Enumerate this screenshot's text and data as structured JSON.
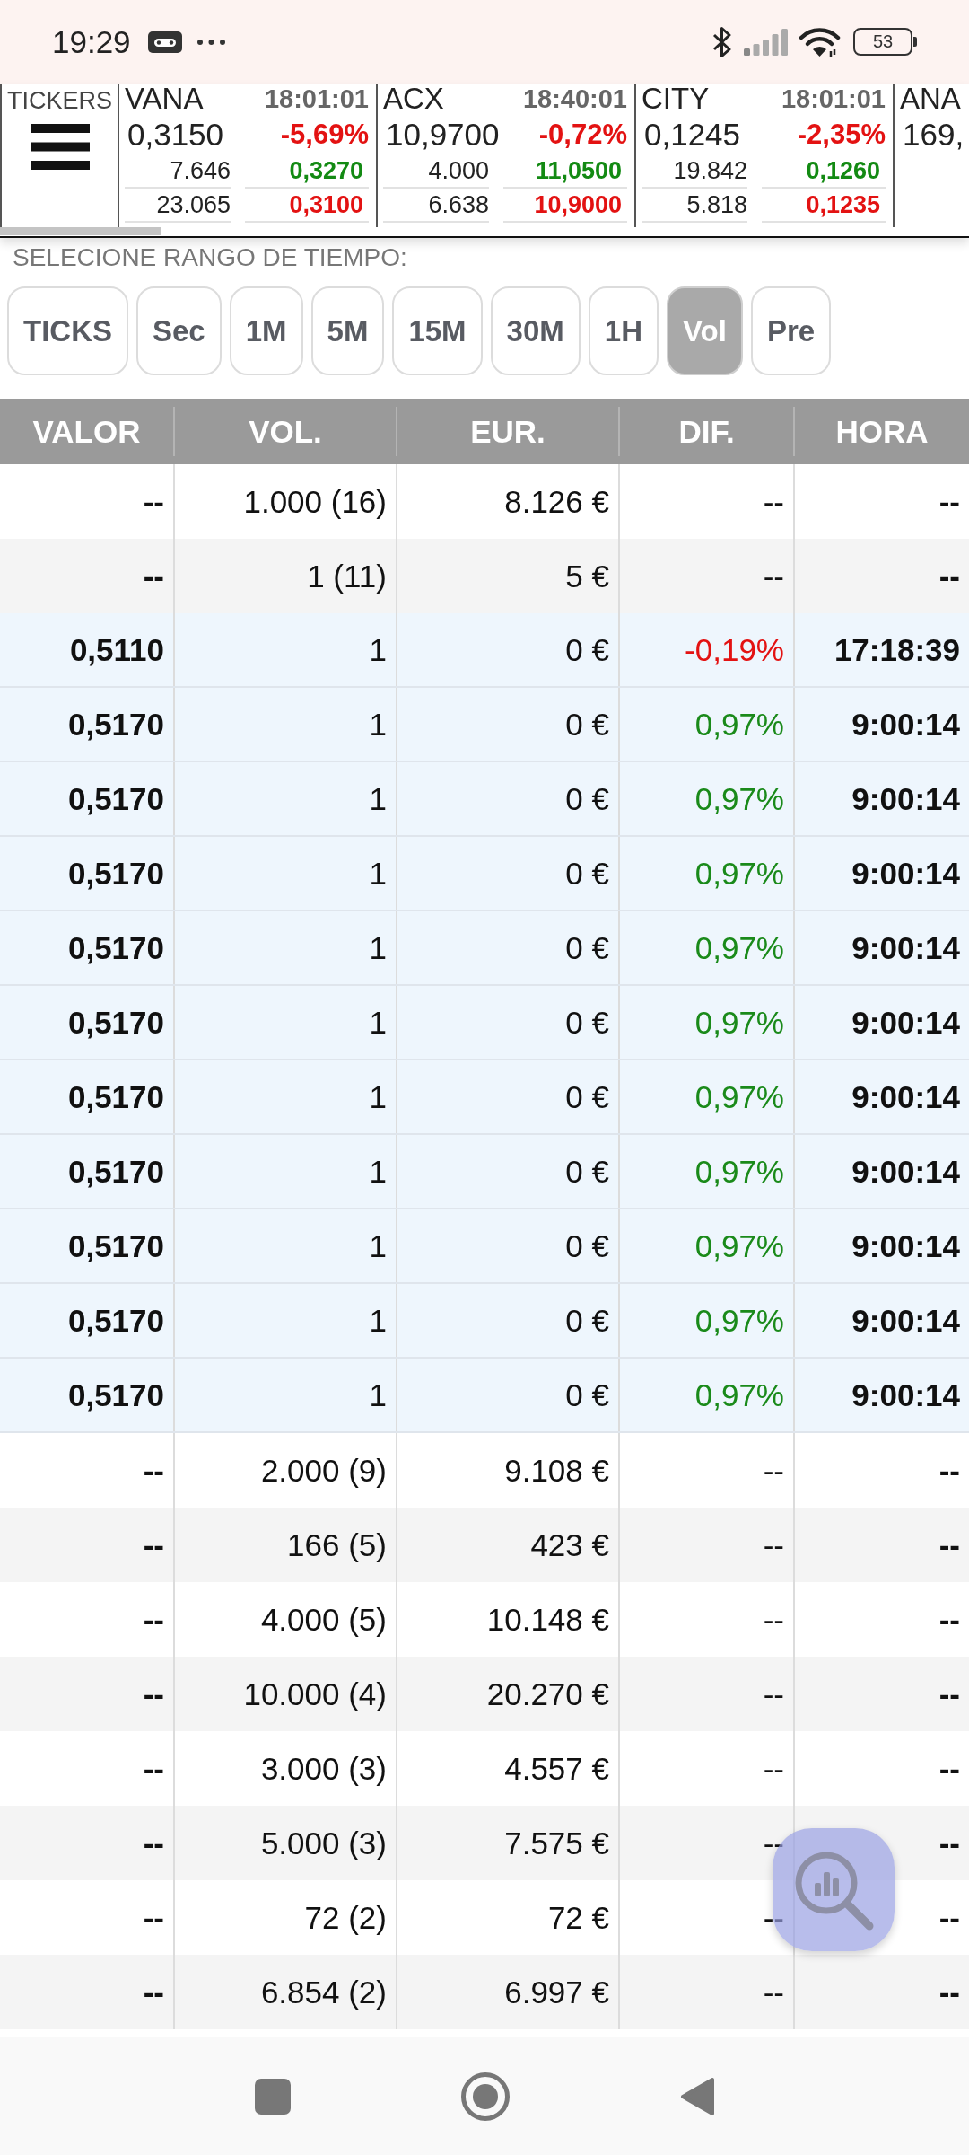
{
  "status_bar": {
    "time": "19:29",
    "battery": "53"
  },
  "ticker_strip": {
    "menu_label": "TICKERS",
    "tickers": [
      {
        "symbol": "VANA",
        "time": "18:01:01",
        "price": "0,3150",
        "change": "-5,69%",
        "rising": false,
        "lines": [
          {
            "volume": "7.646",
            "price": "0,3270",
            "rising": true
          },
          {
            "volume": "23.065",
            "price": "0,3100",
            "rising": false
          }
        ]
      },
      {
        "symbol": "ACX",
        "time": "18:40:01",
        "price": "10,9700",
        "change": "-0,72%",
        "rising": false,
        "lines": [
          {
            "volume": "4.000",
            "price": "11,0500",
            "rising": true
          },
          {
            "volume": "6.638",
            "price": "10,9000",
            "rising": false
          }
        ]
      },
      {
        "symbol": "CITY",
        "time": "18:01:01",
        "price": "0,1245",
        "change": "-2,35%",
        "rising": false,
        "lines": [
          {
            "volume": "19.842",
            "price": "0,1260",
            "rising": true
          },
          {
            "volume": "5.818",
            "price": "0,1235",
            "rising": false
          }
        ]
      },
      {
        "symbol": "ANA",
        "price": "169,"
      }
    ]
  },
  "time_range": {
    "label": "SELECIONE RANGO DE TIEMPO:",
    "options": [
      {
        "label": "TICKS",
        "selected": false
      },
      {
        "label": "Sec",
        "selected": false
      },
      {
        "label": "1M",
        "selected": false
      },
      {
        "label": "5M",
        "selected": false
      },
      {
        "label": "15M",
        "selected": false
      },
      {
        "label": "30M",
        "selected": false
      },
      {
        "label": "1H",
        "selected": false
      },
      {
        "label": "Vol",
        "selected": true
      },
      {
        "label": "Pre",
        "selected": false
      }
    ]
  },
  "table": {
    "columns": [
      "VALOR",
      "VOL.",
      "EUR.",
      "DIF.",
      "HORA"
    ],
    "rows": [
      {
        "kind": "summary",
        "cells": [
          "--",
          "1.000 (16)",
          "8.126 €",
          "--",
          "--"
        ]
      },
      {
        "kind": "summary",
        "cells": [
          "--",
          "1 (11)",
          "5 €",
          "--",
          "--"
        ]
      },
      {
        "kind": "trade",
        "rising": false,
        "cells": [
          "0,5110",
          "1",
          "0 €",
          "-0,19%",
          "17:18:39"
        ]
      },
      {
        "kind": "trade",
        "rising": true,
        "cells": [
          "0,5170",
          "1",
          "0 €",
          "0,97%",
          "9:00:14"
        ]
      },
      {
        "kind": "trade",
        "rising": true,
        "cells": [
          "0,5170",
          "1",
          "0 €",
          "0,97%",
          "9:00:14"
        ]
      },
      {
        "kind": "trade",
        "rising": true,
        "cells": [
          "0,5170",
          "1",
          "0 €",
          "0,97%",
          "9:00:14"
        ]
      },
      {
        "kind": "trade",
        "rising": true,
        "cells": [
          "0,5170",
          "1",
          "0 €",
          "0,97%",
          "9:00:14"
        ]
      },
      {
        "kind": "trade",
        "rising": true,
        "cells": [
          "0,5170",
          "1",
          "0 €",
          "0,97%",
          "9:00:14"
        ]
      },
      {
        "kind": "trade",
        "rising": true,
        "cells": [
          "0,5170",
          "1",
          "0 €",
          "0,97%",
          "9:00:14"
        ]
      },
      {
        "kind": "trade",
        "rising": true,
        "cells": [
          "0,5170",
          "1",
          "0 €",
          "0,97%",
          "9:00:14"
        ]
      },
      {
        "kind": "trade",
        "rising": true,
        "cells": [
          "0,5170",
          "1",
          "0 €",
          "0,97%",
          "9:00:14"
        ]
      },
      {
        "kind": "trade",
        "rising": true,
        "cells": [
          "0,5170",
          "1",
          "0 €",
          "0,97%",
          "9:00:14"
        ]
      },
      {
        "kind": "trade",
        "rising": true,
        "cells": [
          "0,5170",
          "1",
          "0 €",
          "0,97%",
          "9:00:14"
        ]
      },
      {
        "kind": "summary",
        "cells": [
          "--",
          "2.000 (9)",
          "9.108 €",
          "--",
          "--"
        ]
      },
      {
        "kind": "summary",
        "cells": [
          "--",
          "166 (5)",
          "423 €",
          "--",
          "--"
        ]
      },
      {
        "kind": "summary",
        "cells": [
          "--",
          "4.000 (5)",
          "10.148 €",
          "--",
          "--"
        ]
      },
      {
        "kind": "summary",
        "cells": [
          "--",
          "10.000 (4)",
          "20.270 €",
          "--",
          "--"
        ]
      },
      {
        "kind": "summary",
        "cells": [
          "--",
          "3.000 (3)",
          "4.557 €",
          "--",
          "--"
        ]
      },
      {
        "kind": "summary",
        "cells": [
          "--",
          "5.000 (3)",
          "7.575 €",
          "--",
          "--"
        ]
      },
      {
        "kind": "summary",
        "cells": [
          "--",
          "72 (2)",
          "72 €",
          "--",
          "--"
        ]
      },
      {
        "kind": "summary",
        "cells": [
          "--",
          "6.854 (2)",
          "6.997 €",
          "--",
          "--"
        ]
      }
    ]
  }
}
